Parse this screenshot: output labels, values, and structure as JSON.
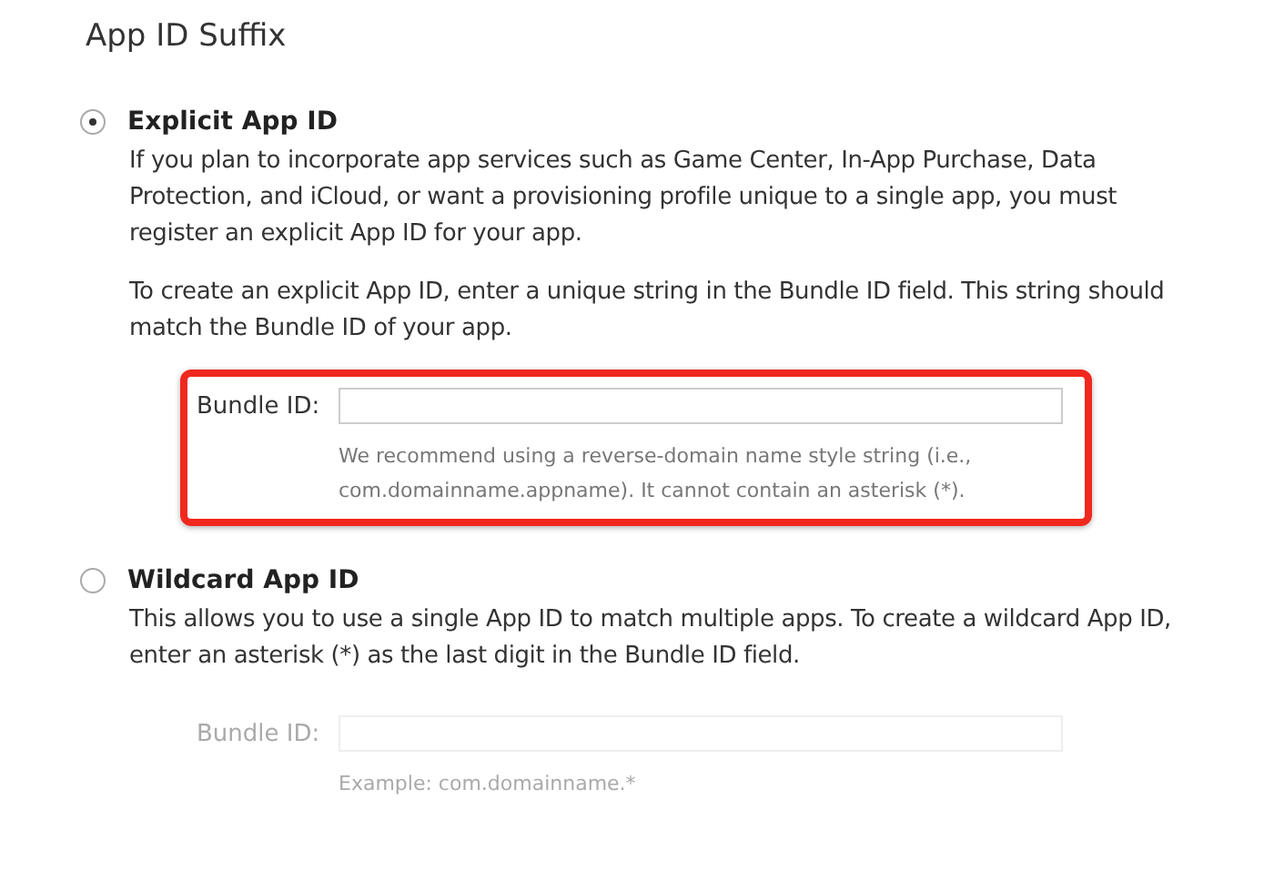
{
  "section_title": "App ID Suffix",
  "options": [
    {
      "label": "Explicit App ID",
      "selected": true,
      "paragraphs": [
        "If you plan to incorporate app services such as Game Center, In-App Purchase, Data Protection, and iCloud, or want a provisioning profile unique to a single app, you must register an explicit App ID for your app.",
        "To create an explicit App ID, enter a unique string in the Bundle ID field. This string should match the Bundle ID of your app."
      ],
      "field": {
        "label": "Bundle ID:",
        "help": "We recommend using a reverse-domain name style string (i.e., com.domainname.appname). It cannot contain an asterisk (*).",
        "disabled": false,
        "highlighted": true
      }
    },
    {
      "label": "Wildcard App ID",
      "selected": false,
      "paragraphs": [
        "This allows you to use a single App ID to match multiple apps. To create a wildcard App ID, enter an asterisk (*) as the last digit in the Bundle ID field."
      ],
      "field": {
        "label": "Bundle ID:",
        "help": "Example: com.domainname.*",
        "disabled": true,
        "highlighted": false
      }
    }
  ]
}
